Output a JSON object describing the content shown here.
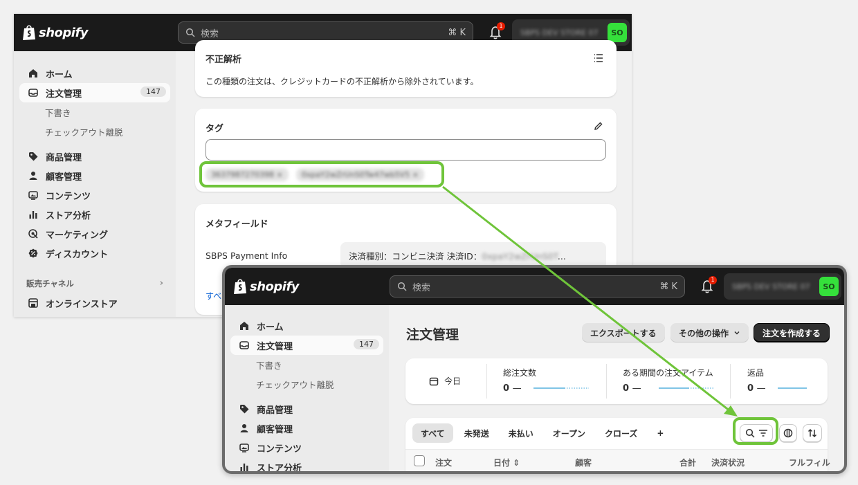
{
  "brand": {
    "name": "shopify",
    "accent": "#35e03b",
    "highlight": "#6fc43a"
  },
  "topbar": {
    "search_placeholder": "検索",
    "search_shortcut": "⌘ K",
    "notification_count": "1",
    "store_name": "SBPS DEV STORE 07",
    "avatar_initials": "SO"
  },
  "sidebar": {
    "items": [
      {
        "label": "ホーム",
        "icon": "home-icon"
      },
      {
        "label": "注文管理",
        "icon": "inbox-icon",
        "count": "147"
      },
      {
        "label": "商品管理",
        "icon": "tag-icon"
      },
      {
        "label": "顧客管理",
        "icon": "person-icon"
      },
      {
        "label": "コンテンツ",
        "icon": "image-icon"
      },
      {
        "label": "ストア分析",
        "icon": "chart-icon"
      },
      {
        "label": "マーケティング",
        "icon": "target-icon"
      },
      {
        "label": "ディスカウント",
        "icon": "discount-icon"
      }
    ],
    "subitems": [
      "下書き",
      "チェックアウト離脱"
    ],
    "section_label": "販売チャネル",
    "channel_item": "オンラインストア"
  },
  "order_detail": {
    "fraud": {
      "title": "不正解析",
      "text": "この種類の注文は、クレジットカードの不正解析から除外されています。"
    },
    "tags": {
      "title": "タグ",
      "chips": [
        "3637987270398 ×",
        "0xpaY2wZrUnS0Tw47wb5V5 ×"
      ]
    },
    "metafields": {
      "title": "メタフィールド",
      "field_label": "SBPS Payment Info",
      "field_value_prefix": "決済種別：コンビニ決済 決済ID：",
      "field_value_hidden": "0xpaY2wZrUnS0T",
      "field_value_ellipsis": "...",
      "show_all_link": "すべ"
    }
  },
  "orders_page": {
    "title": "注文管理",
    "buttons": {
      "export": "エクスポートする",
      "more_actions": "その他の操作",
      "create": "注文を作成する"
    },
    "stats": {
      "today": "今日",
      "items": [
        {
          "label": "総注文数",
          "value": "0",
          "dash": "—"
        },
        {
          "label": "ある期間の注文アイテム",
          "value": "0",
          "dash": "—"
        },
        {
          "label": "返品",
          "value": "0",
          "dash": "—"
        }
      ]
    },
    "tabs": [
      "すべて",
      "未発送",
      "未払い",
      "オープン",
      "クローズ",
      "+"
    ],
    "columns": [
      "注文",
      "日付",
      "顧客",
      "合計",
      "決済状況",
      "フルフィル"
    ]
  }
}
